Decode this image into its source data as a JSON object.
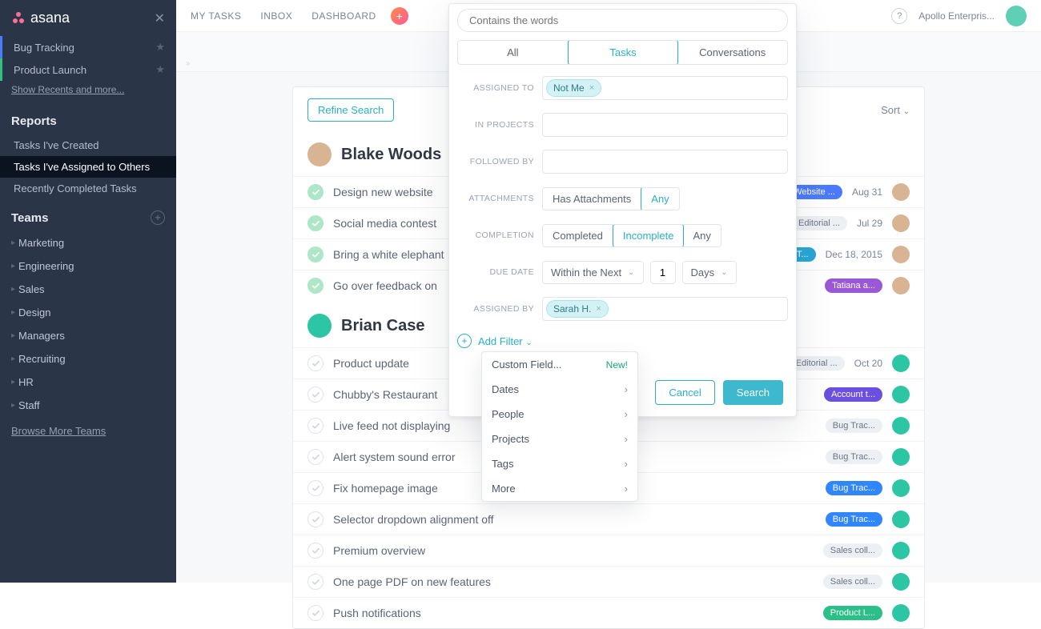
{
  "brand": "asana",
  "sidebar": {
    "recents": [
      {
        "label": "Bug Tracking",
        "accent": "proj-blue"
      },
      {
        "label": "Product Launch",
        "accent": "proj-green"
      }
    ],
    "show_recents": "Show Recents and more...",
    "reports_heading": "Reports",
    "reports": [
      {
        "label": "Tasks I've Created",
        "active": false
      },
      {
        "label": "Tasks I've Assigned to Others",
        "active": true
      },
      {
        "label": "Recently Completed Tasks",
        "active": false
      }
    ],
    "teams_heading": "Teams",
    "teams": [
      "Marketing",
      "Engineering",
      "Sales",
      "Design",
      "Managers",
      "Recruiting",
      "HR",
      "Staff"
    ],
    "browse": "Browse More Teams"
  },
  "topnav": [
    "MY TASKS",
    "INBOX",
    "DASHBOARD"
  ],
  "workspace": "Apollo Enterpris...",
  "panel": {
    "refine": "Refine Search",
    "sort": "Sort",
    "groups": [
      {
        "name": "Blake Woods",
        "avatar": "ava-blake",
        "row_avatar": "blake",
        "tasks": [
          {
            "title": "Design new website",
            "done": true,
            "pills": [
              {
                "text": "",
                "color": "#ff5a6e",
                "round": true
              },
              {
                "text": "Website ...",
                "color": "#4a7bff"
              }
            ],
            "date": "Aug 31"
          },
          {
            "title": "Social media contest",
            "done": true,
            "pills": [
              {
                "text": "",
                "color": "#17c28b",
                "round": true
              },
              {
                "text": "Editorial ...",
                "color": "#eceff3",
                "grey": true
              }
            ],
            "date": "Jul 29"
          },
          {
            "title": "Bring a white elephant",
            "done": true,
            "pills": [
              {
                "text": "eekly T...",
                "color": "#2aa7d6"
              }
            ],
            "date": "Dec 18, 2015"
          },
          {
            "title": "Go over feedback on",
            "done": true,
            "pills": [
              {
                "text": "Tatiana a...",
                "color": "#9a57d6"
              }
            ],
            "date": ""
          }
        ]
      },
      {
        "name": "Brian Case",
        "avatar": "ava-brian",
        "row_avatar": "brian",
        "tasks": [
          {
            "title": "Product update",
            "done": false,
            "pills": [
              {
                "text": "Editorial ...",
                "color": "#eceff3",
                "grey": true
              }
            ],
            "date": "Oct 20"
          },
          {
            "title": "Chubby's Restaurant",
            "done": false,
            "pills": [
              {
                "text": "Account t...",
                "color": "#6a4fe0"
              }
            ],
            "date": ""
          },
          {
            "title": "Live feed not displaying",
            "done": false,
            "pills": [
              {
                "text": "Bug Trac...",
                "color": "#eceff3",
                "grey": true
              }
            ],
            "date": ""
          },
          {
            "title": "Alert system sound error",
            "done": false,
            "pills": [
              {
                "text": "Bug Trac...",
                "color": "#eceff3",
                "grey": true
              }
            ],
            "date": ""
          },
          {
            "title": "Fix homepage image",
            "done": false,
            "pills": [
              {
                "text": "Bug Trac...",
                "color": "#2f86ff"
              }
            ],
            "date": ""
          },
          {
            "title": "Selector dropdown alignment off",
            "done": false,
            "pills": [
              {
                "text": "Bug Trac...",
                "color": "#2f86ff"
              }
            ],
            "date": ""
          },
          {
            "title": "Premium overview",
            "done": false,
            "pills": [
              {
                "text": "Sales coll...",
                "color": "#eceff3",
                "grey": true
              }
            ],
            "date": ""
          },
          {
            "title": "One page PDF on new features",
            "done": false,
            "pills": [
              {
                "text": "Sales coll...",
                "color": "#eceff3",
                "grey": true
              }
            ],
            "date": ""
          },
          {
            "title": "Push notifications",
            "done": false,
            "pills": [
              {
                "text": "Product L...",
                "color": "#2bbf8a"
              }
            ],
            "date": ""
          }
        ]
      }
    ]
  },
  "popover": {
    "placeholder": "Contains the words",
    "tabs": [
      "All",
      "Tasks",
      "Conversations"
    ],
    "tabs_active": 1,
    "labels": {
      "assigned_to": "ASSIGNED TO",
      "in_projects": "IN PROJECTS",
      "followed_by": "FOLLOWED BY",
      "attachments": "ATTACHMENTS",
      "completion": "COMPLETION",
      "due_date": "DUE DATE",
      "assigned_by": "ASSIGNED BY"
    },
    "assigned_to_chip": "Not Me",
    "attachments_options": [
      "Has Attachments",
      "Any"
    ],
    "attachments_active": 1,
    "completion_options": [
      "Completed",
      "Incomplete",
      "Any"
    ],
    "completion_active": 1,
    "due_operator": "Within the Next",
    "due_value": "1",
    "due_unit": "Days",
    "assigned_by_chip": "Sarah H.",
    "add_filter": "Add Filter",
    "menu": [
      {
        "label": "Custom Field...",
        "badge": "New!"
      },
      {
        "label": "Dates",
        "sub": true
      },
      {
        "label": "People",
        "sub": true
      },
      {
        "label": "Projects",
        "sub": true
      },
      {
        "label": "Tags",
        "sub": true
      },
      {
        "label": "More",
        "sub": true
      }
    ],
    "cancel": "Cancel",
    "search": "Search"
  }
}
